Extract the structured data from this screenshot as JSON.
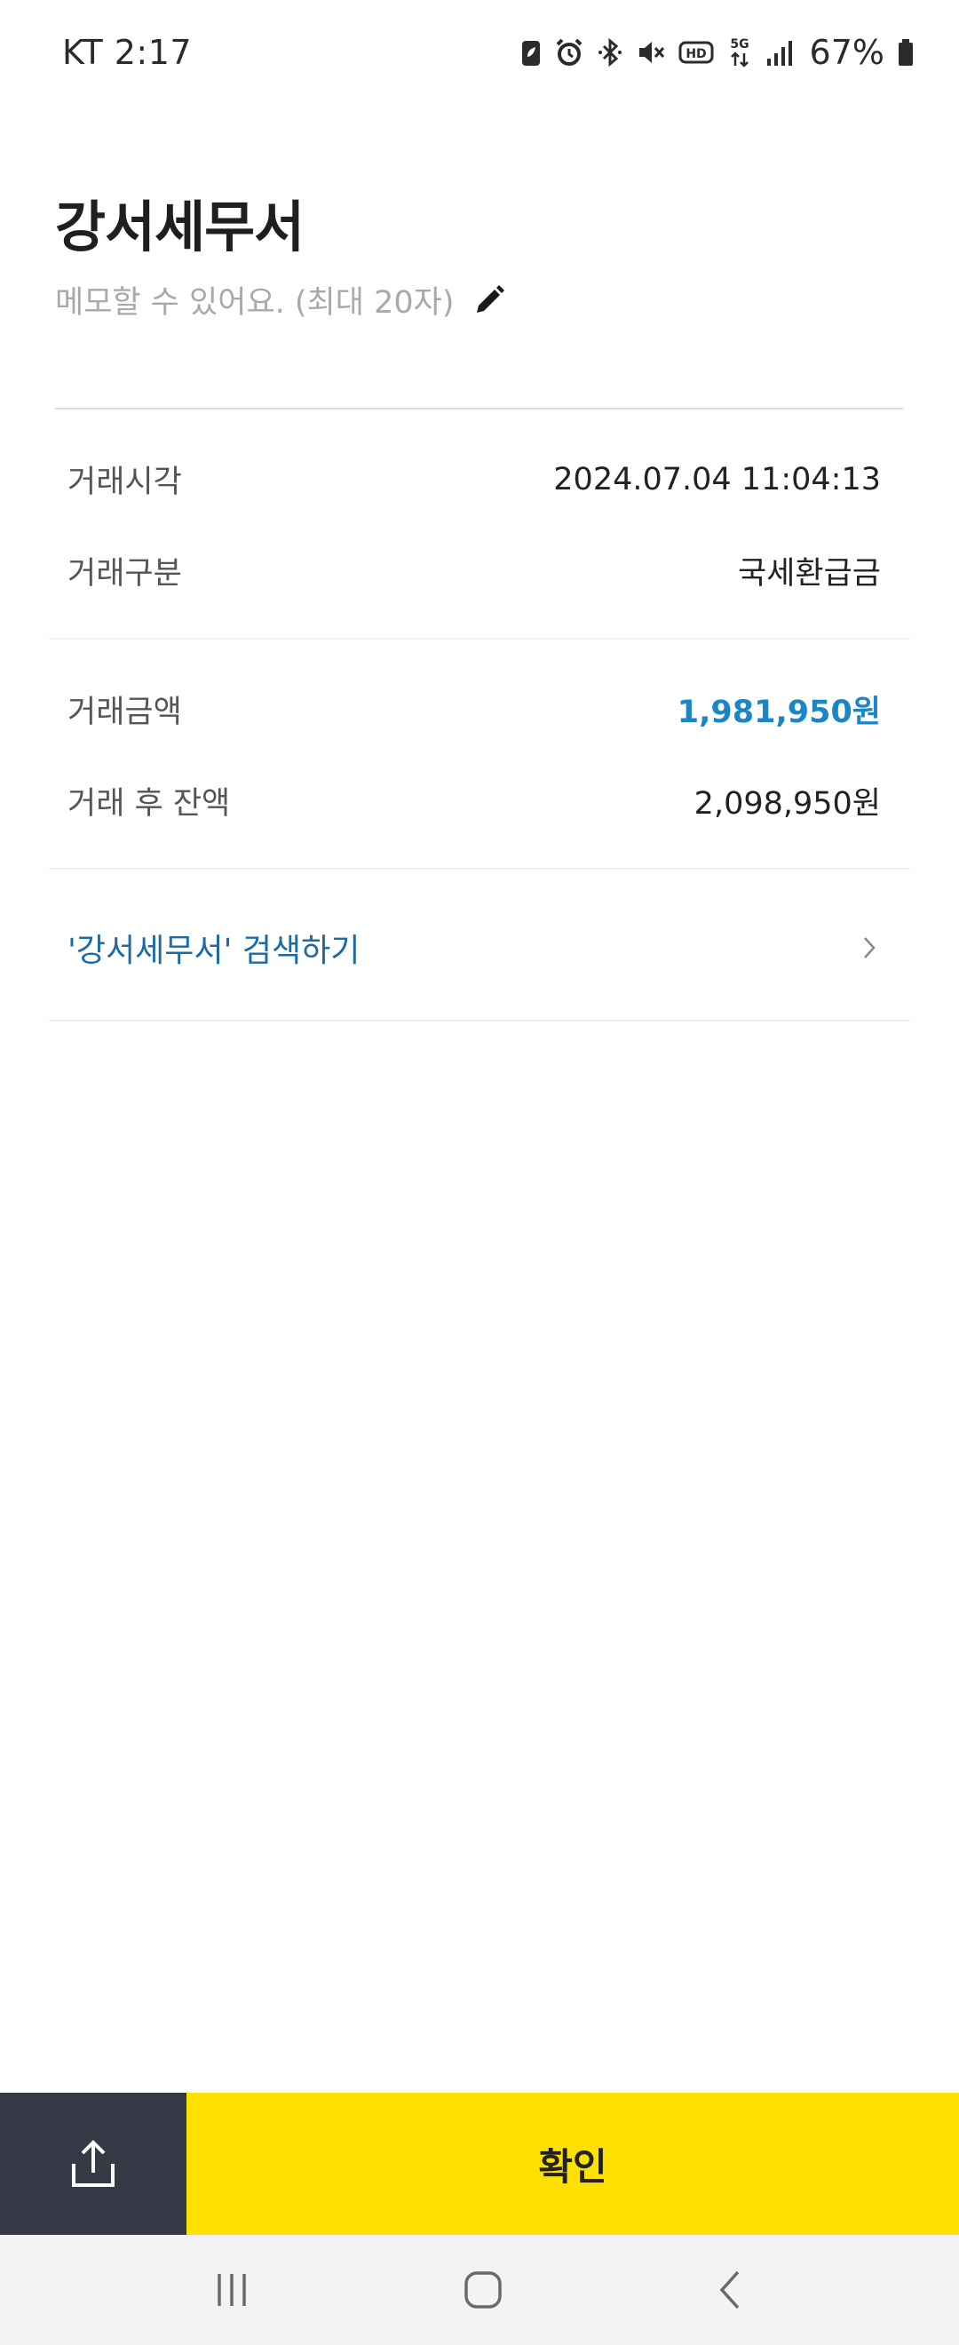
{
  "status_bar": {
    "carrier_time": "KT 2:17",
    "battery_percent": "67%",
    "icons": [
      "battery-saver-icon",
      "alarm-icon",
      "bluetooth-icon",
      "mute-icon",
      "hd-icon",
      "5g-icon",
      "signal-icon",
      "battery-icon"
    ]
  },
  "header": {
    "title": "강서세무서",
    "memo_placeholder": "메모할 수 있어요. (최대 20자)",
    "edit_icon": "pencil-icon"
  },
  "details": {
    "time_label": "거래시각",
    "time_value": "2024.07.04 11:04:13",
    "type_label": "거래구분",
    "type_value": "국세환급금",
    "amount_label": "거래금액",
    "amount_value": "1,981,950원",
    "balance_label": "거래 후 잔액",
    "balance_value": "2,098,950원"
  },
  "search_link": {
    "label": "'강서세무서' 검색하기",
    "icon": "chevron-right-icon"
  },
  "bottom_bar": {
    "share_icon": "share-icon",
    "confirm_label": "확인"
  },
  "nav_bar": {
    "icons": [
      "recent-apps-icon",
      "home-icon",
      "back-icon"
    ]
  },
  "colors": {
    "accent_yellow": "#fee100",
    "amount_blue": "#1a86c8",
    "link_blue": "#1d6aa5",
    "share_bg": "#353a46"
  }
}
